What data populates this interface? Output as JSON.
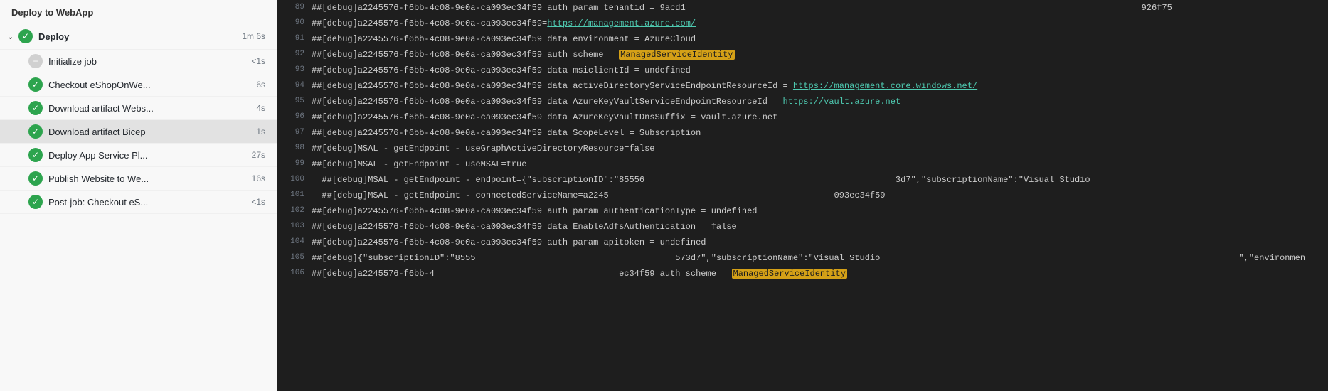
{
  "panel": {
    "title": "Deploy to WebApp",
    "jobs": [
      {
        "id": "deploy-job",
        "label": "Deploy",
        "duration": "1m 6s",
        "status": "success",
        "expanded": true,
        "steps": [
          {
            "id": "init",
            "label": "Initialize job",
            "duration": "<1s",
            "status": "skipped"
          },
          {
            "id": "checkout",
            "label": "Checkout eShopOnWe...",
            "duration": "6s",
            "status": "success"
          },
          {
            "id": "download-webs",
            "label": "Download artifact Webs...",
            "duration": "4s",
            "status": "success"
          },
          {
            "id": "download-bicep",
            "label": "Download artifact Bicep",
            "duration": "1s",
            "status": "success",
            "active": true
          },
          {
            "id": "deploy-app",
            "label": "Deploy App Service Pl...",
            "duration": "27s",
            "status": "success"
          },
          {
            "id": "publish-website",
            "label": "Publish Website to We...",
            "duration": "16s",
            "status": "success"
          },
          {
            "id": "post-checkout",
            "label": "Post-job: Checkout eS...",
            "duration": "<1s",
            "status": "success"
          }
        ]
      }
    ]
  },
  "log": {
    "lines": [
      {
        "num": 89,
        "text": "##[debug]a2245576-f6bb-4c08-9e0a-ca093ec34f59 auth param tenantid = 9acd1",
        "suffix": "926f75"
      },
      {
        "num": 90,
        "text": "##[debug]a2245576-f6bb-4c08-9e0a-ca093ec34f59=",
        "link": "https://management.azure.com/",
        "rest": ""
      },
      {
        "num": 91,
        "text": "##[debug]a2245576-f6bb-4c08-9e0a-ca093ec34f59 data environment = AzureCloud",
        "highlight": null
      },
      {
        "num": 92,
        "text": "##[debug]a2245576-f6bb-4c08-9e0a-ca093ec34f59 auth scheme = ",
        "highlight": "ManagedServiceIdentity",
        "rest": ""
      },
      {
        "num": 93,
        "text": "##[debug]a2245576-f6bb-4c08-9e0a-ca093ec34f59 data msiclientId = undefined",
        "highlight": null
      },
      {
        "num": 94,
        "text": "##[debug]a2245576-f6bb-4c08-9e0a-ca093ec34f59 data activeDirectoryServiceEndpointResourceId = ",
        "link": "https://management.core.windows.net/",
        "rest": ""
      },
      {
        "num": 95,
        "text": "##[debug]a2245576-f6bb-4c08-9e0a-ca093ec34f59 data AzureKeyVaultServiceEndpointResourceId = ",
        "link": "https://vault.azure.net",
        "rest": ""
      },
      {
        "num": 96,
        "text": "##[debug]a2245576-f6bb-4c08-9e0a-ca093ec34f59 data AzureKeyVaultDnsSuffix = vault.azure.net",
        "highlight": null
      },
      {
        "num": 97,
        "text": "##[debug]a2245576-f6bb-4c08-9e0a-ca093ec34f59 data ScopeLevel = Subscription",
        "highlight": null
      },
      {
        "num": 98,
        "text": "##[debug]MSAL - getEndpoint - useGraphActiveDirectoryResource=false",
        "highlight": null
      },
      {
        "num": 99,
        "text": "##[debug]MSAL - getEndpoint - useMSAL=true",
        "highlight": null
      },
      {
        "num": 100,
        "text": "  ##[debug]MSAL - getEndpoint - endpoint={\"subscriptionID\":\"85556",
        "suffix": "3d7\",\"subscriptionName\":\"Visual Studio"
      },
      {
        "num": 101,
        "text": "  ##[debug]MSAL - getEndpoint - connectedServiceName=a2245",
        "suffix": "093ec34f59"
      },
      {
        "num": 102,
        "text": "##[debug]a2245576-f6bb-4c08-9e0a-ca093ec34f59 auth param authenticationType = undefined",
        "highlight": null
      },
      {
        "num": 103,
        "text": "##[debug]a2245576-f6bb-4c08-9e0a-ca093ec34f59 data EnableAdfsAuthentication = false",
        "highlight": null
      },
      {
        "num": 104,
        "text": "##[debug]a2245576-f6bb-4c08-9e0a-ca093ec34f59 auth param apitoken = undefined",
        "highlight": null
      },
      {
        "num": 105,
        "text": "##[debug]{\"subscriptionID\":\"8555",
        "suffix": "573d7\",\"subscriptionName\":\"Visual Studio ⁠",
        "rest2": "\",\"environmen"
      },
      {
        "num": 106,
        "text": "##[debug]a2245576-f6bb-4",
        "suffix": "ec34f59 auth scheme = ",
        "highlight2": "ManagedServiceIdentity"
      }
    ]
  }
}
